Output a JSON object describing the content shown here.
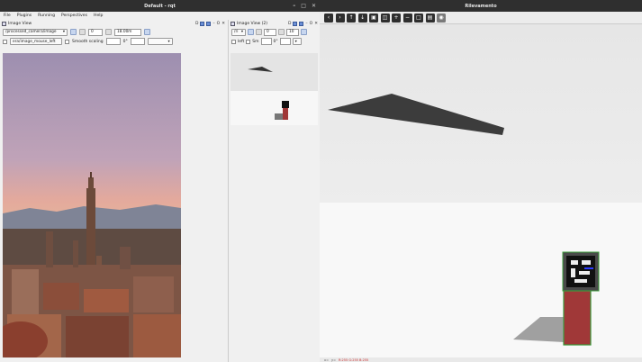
{
  "left_window": {
    "title": "Default - rqt",
    "controls": [
      "–",
      "□",
      "✕"
    ],
    "menu": [
      "File",
      "Plugins",
      "Running",
      "Perspectives",
      "Help"
    ]
  },
  "panel1": {
    "title": "Image View",
    "title_icons": [
      "D",
      "?",
      "–",
      "O",
      "✕"
    ],
    "topic": "/processed_camera/image",
    "spin_value": "0",
    "zoom_value": "18.00m",
    "mouse_topic": "era/image_mouse_left",
    "smooth_label": "Smooth scaling",
    "rotation": "0°"
  },
  "panel2": {
    "title": "Image View (2)",
    "title_icons": [
      "D",
      "?",
      "–",
      "O",
      "✕"
    ],
    "topic": "/ri",
    "spin_value": "0",
    "zoom_value": "10",
    "mouse_topic": "left",
    "smooth_label": "Sm",
    "rotation": "0°"
  },
  "right_window": {
    "title": "Rilevamento",
    "toolbar_icons": [
      "arrow-left-icon",
      "arrow-right-icon",
      "arrow-up-icon",
      "arrow-down-icon",
      "save-icon",
      "zoom-fit-icon",
      "zoom-in-icon",
      "zoom-out-icon",
      "zoom-original-icon",
      "crop-icon",
      "settings-icon"
    ],
    "status_texts": [
      "x=",
      "y=",
      "R:255 G:255 B:255"
    ]
  },
  "colors": {
    "titlebar": "#2f2f2f",
    "panel_bg": "#f0f0f0",
    "marker_green": "#3c9b3c",
    "box_red": "#a03838"
  }
}
